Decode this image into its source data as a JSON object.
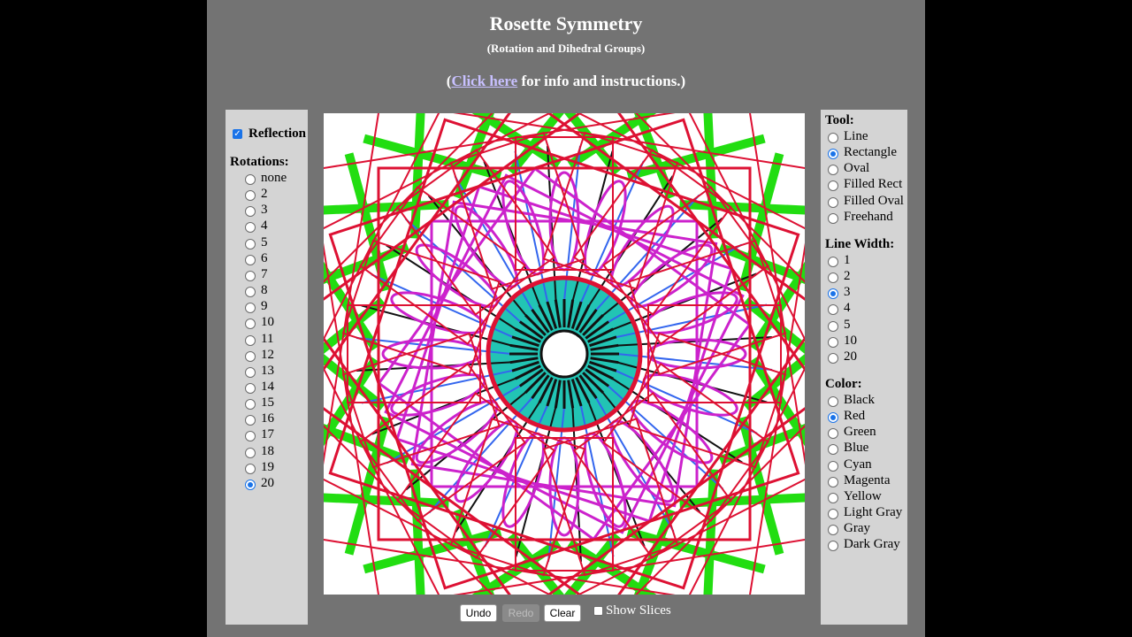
{
  "header": {
    "title": "Rosette Symmetry",
    "subtitle": "(Rotation and Dihedral Groups)",
    "info_prefix": "(",
    "info_link": "Click here",
    "info_suffix": " for info and instructions.)"
  },
  "left": {
    "reflection_label": "Reflection",
    "reflection_checked": true,
    "rotations_heading": "Rotations:",
    "rotations": [
      "none",
      "2",
      "3",
      "4",
      "5",
      "6",
      "7",
      "8",
      "9",
      "10",
      "11",
      "12",
      "13",
      "14",
      "15",
      "16",
      "17",
      "18",
      "19",
      "20"
    ],
    "selected_rotation": "20"
  },
  "right": {
    "tool_heading": "Tool:",
    "tools": [
      "Line",
      "Rectangle",
      "Oval",
      "Filled Rect",
      "Filled Oval",
      "Freehand"
    ],
    "selected_tool": "Rectangle",
    "width_heading": "Line Width:",
    "widths": [
      "1",
      "2",
      "3",
      "4",
      "5",
      "10",
      "20"
    ],
    "selected_width": "3",
    "color_heading": "Color:",
    "colors": [
      "Black",
      "Red",
      "Green",
      "Blue",
      "Cyan",
      "Magenta",
      "Yellow",
      "Light Gray",
      "Gray",
      "Dark Gray"
    ],
    "selected_color": "Red"
  },
  "toolbar": {
    "undo": "Undo",
    "redo": "Redo",
    "clear": "Clear",
    "show_slices": "Show Slices",
    "show_slices_checked": false
  },
  "drawing_colors": {
    "green": "#22dd11",
    "red": "#dd1133",
    "magenta": "#cc22cc",
    "cyan": "#22c4b4",
    "black": "#111111",
    "blue": "#3366ee"
  }
}
